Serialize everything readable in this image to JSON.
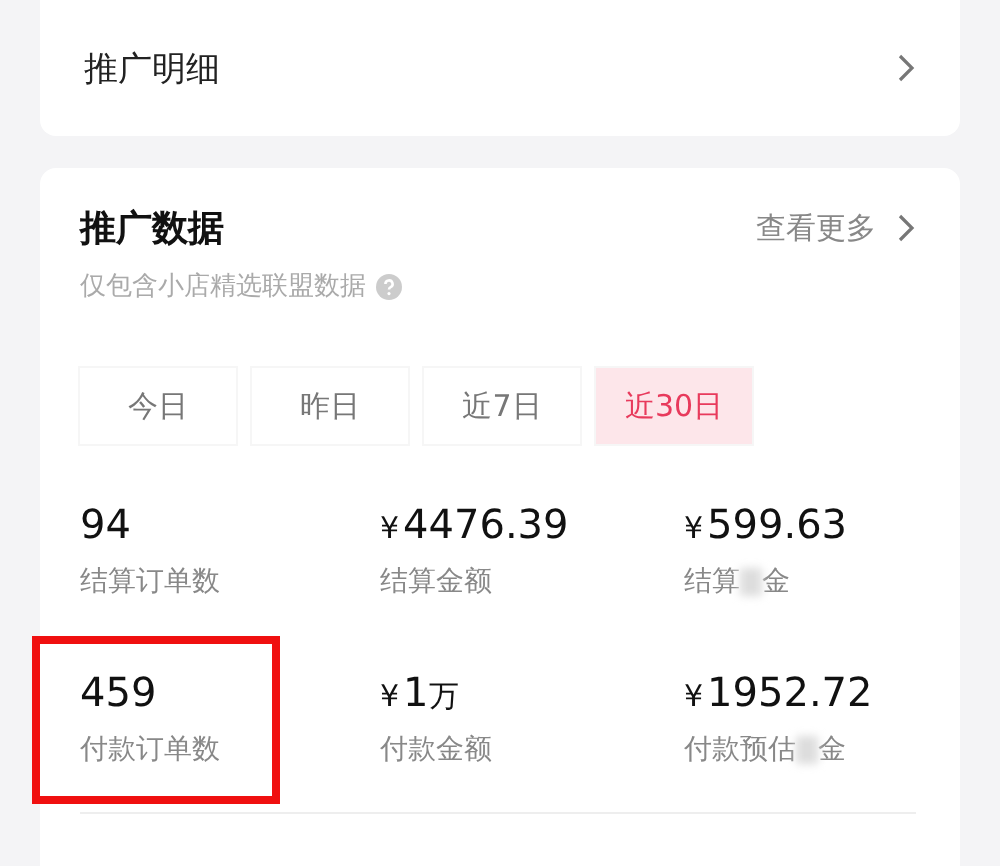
{
  "detail_card": {
    "title": "推广明细"
  },
  "data_card": {
    "title": "推广数据",
    "more": "查看更多",
    "subtitle": "仅包含小店精选联盟数据"
  },
  "tabs": [
    {
      "label": "今日",
      "selected": false
    },
    {
      "label": "昨日",
      "selected": false
    },
    {
      "label": "近7日",
      "selected": false
    },
    {
      "label": "近30日",
      "selected": true
    }
  ],
  "stats": [
    {
      "amount": "94",
      "label": "结算订单数",
      "highlighted": false
    },
    {
      "currency": "¥",
      "amount": "4476.39",
      "label": "结算金额",
      "highlighted": false
    },
    {
      "currency": "¥",
      "amount": "599.63",
      "label": "结算",
      "label_end": "金",
      "redacted": true,
      "highlighted": false
    },
    {
      "amount": "459",
      "label": "付款订单数",
      "highlighted": true
    },
    {
      "currency": "¥",
      "amount": "1",
      "unit": "万",
      "label": "付款金额",
      "highlighted": false
    },
    {
      "currency": "¥",
      "amount": "1952.72",
      "label": "付款预估",
      "label_end": "金",
      "redacted": true,
      "highlighted": false
    }
  ]
}
